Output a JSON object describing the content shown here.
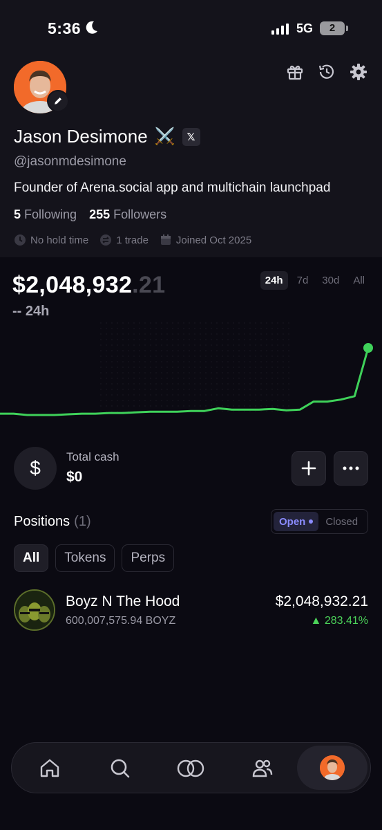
{
  "status_bar": {
    "time": "5:36",
    "network": "5G",
    "battery": "2"
  },
  "profile": {
    "name": "Jason Desimone",
    "name_emoji": "⚔️",
    "x_badge": "𝕏",
    "handle": "@jasonmdesimone",
    "bio": "Founder of Arena.social app and multichain launchpad",
    "following_count": "5",
    "following_label": "Following",
    "followers_count": "255",
    "followers_label": "Followers",
    "meta": [
      {
        "icon": "clock-icon",
        "text": "No hold time"
      },
      {
        "icon": "swap-icon",
        "text": "1 trade"
      },
      {
        "icon": "calendar-icon",
        "text": "Joined Oct 2025"
      }
    ]
  },
  "portfolio": {
    "value_main": "$2,048,932",
    "value_cents": ".21",
    "change": "-- 24h",
    "ranges": [
      "24h",
      "7d",
      "30d",
      "All"
    ],
    "active_range": "24h"
  },
  "chart_data": {
    "type": "line",
    "series": [
      {
        "values": [
          0.02,
          0.02,
          0.0,
          0.0,
          0.0,
          0.01,
          0.02,
          0.02,
          0.03,
          0.03,
          0.04,
          0.05,
          0.05,
          0.05,
          0.06,
          0.06,
          0.1,
          0.08,
          0.08,
          0.08,
          0.09,
          0.07,
          0.08,
          0.2,
          0.2,
          0.23,
          0.28,
          1.0
        ]
      }
    ],
    "color": "#3fd25a",
    "grid": false
  },
  "cash": {
    "icon": "dollar-icon",
    "label": "Total cash",
    "value": "$0"
  },
  "positions": {
    "title": "Positions",
    "count": "(1)",
    "toggle": {
      "open": "Open",
      "closed": "Closed"
    },
    "filters": [
      "All",
      "Tokens",
      "Perps"
    ],
    "rows": [
      {
        "name": "Boyz N The Hood",
        "amount": "600,007,575.94 BOYZ",
        "value": "$2,048,932.21",
        "change": "▲ 283.41%"
      }
    ]
  },
  "colors": {
    "background": "#0b0a12",
    "surface": "#14131b",
    "accent": "#8b8cff",
    "positive": "#4cd45a",
    "brand": "#f26a2a"
  }
}
